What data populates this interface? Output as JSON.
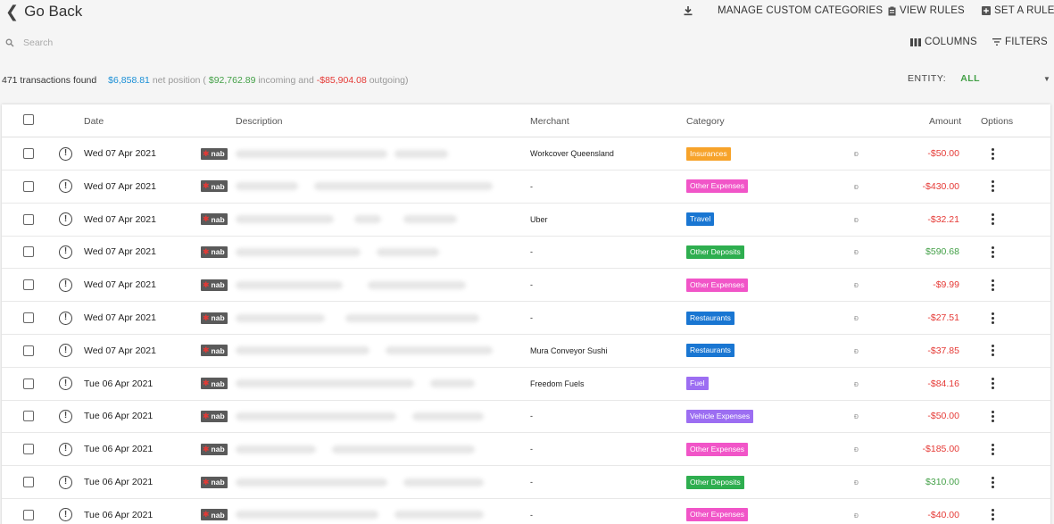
{
  "header": {
    "back_label": "Go Back",
    "manage_label": "MANAGE CUSTOM CATEGORIES",
    "view_rules_label": "VIEW RULES",
    "set_rule_label": "SET A RULE",
    "columns_label": "COLUMNS",
    "filters_label": "FILTERS"
  },
  "search": {
    "placeholder": "Search"
  },
  "summary": {
    "count": "471 transactions found",
    "net": "$6,858.81",
    "net_label": "net position (",
    "incoming": "$92,762.89",
    "incoming_label": "incoming and",
    "outgoing": "-$85,904.08",
    "outgoing_label": "outgoing)"
  },
  "entity": {
    "label": "ENTITY:",
    "value": "ALL"
  },
  "table": {
    "headers": {
      "date": "Date",
      "description": "Description",
      "merchant": "Merchant",
      "category": "Category",
      "amount": "Amount",
      "options": "Options"
    },
    "rows": [
      {
        "date": "Wed 07 Apr 2021",
        "bank": "nab",
        "merchant": "Workcover Queensland",
        "category": "Insurances",
        "cat_color": "#f7a32a",
        "amount": "-$50.00",
        "amt_color": "#e53935"
      },
      {
        "date": "Wed 07 Apr 2021",
        "bank": "nab",
        "merchant": "-",
        "category": "Other Expenses",
        "cat_color": "#f155c8",
        "amount": "-$430.00",
        "amt_color": "#e53935"
      },
      {
        "date": "Wed 07 Apr 2021",
        "bank": "nab",
        "merchant": "Uber",
        "category": "Travel",
        "cat_color": "#1976d2",
        "amount": "-$32.21",
        "amt_color": "#e53935"
      },
      {
        "date": "Wed 07 Apr 2021",
        "bank": "nab",
        "merchant": "-",
        "category": "Other Deposits",
        "cat_color": "#2eae4f",
        "amount": "$590.68",
        "amt_color": "#43a047"
      },
      {
        "date": "Wed 07 Apr 2021",
        "bank": "nab",
        "merchant": "-",
        "category": "Other Expenses",
        "cat_color": "#f155c8",
        "amount": "-$9.99",
        "amt_color": "#e53935"
      },
      {
        "date": "Wed 07 Apr 2021",
        "bank": "nab",
        "merchant": "-",
        "category": "Restaurants",
        "cat_color": "#1976d2",
        "amount": "-$27.51",
        "amt_color": "#e53935"
      },
      {
        "date": "Wed 07 Apr 2021",
        "bank": "nab",
        "merchant": "Mura Conveyor Sushi",
        "category": "Restaurants",
        "cat_color": "#1976d2",
        "amount": "-$37.85",
        "amt_color": "#e53935"
      },
      {
        "date": "Tue 06 Apr 2021",
        "bank": "nab",
        "merchant": "Freedom Fuels",
        "category": "Fuel",
        "cat_color": "#9c6ef2",
        "amount": "-$84.16",
        "amt_color": "#e53935"
      },
      {
        "date": "Tue 06 Apr 2021",
        "bank": "nab",
        "merchant": "-",
        "category": "Vehicle Expenses",
        "cat_color": "#9c6ef2",
        "amount": "-$50.00",
        "amt_color": "#e53935"
      },
      {
        "date": "Tue 06 Apr 2021",
        "bank": "nab",
        "merchant": "-",
        "category": "Other Expenses",
        "cat_color": "#f155c8",
        "amount": "-$185.00",
        "amt_color": "#e53935"
      },
      {
        "date": "Tue 06 Apr 2021",
        "bank": "nab",
        "merchant": "-",
        "category": "Other Deposits",
        "cat_color": "#2eae4f",
        "amount": "$310.00",
        "amt_color": "#43a047"
      },
      {
        "date": "Tue 06 Apr 2021",
        "bank": "nab",
        "merchant": "-",
        "category": "Other Expenses",
        "cat_color": "#f155c8",
        "amount": "-$40.00",
        "amt_color": "#e53935"
      }
    ]
  }
}
